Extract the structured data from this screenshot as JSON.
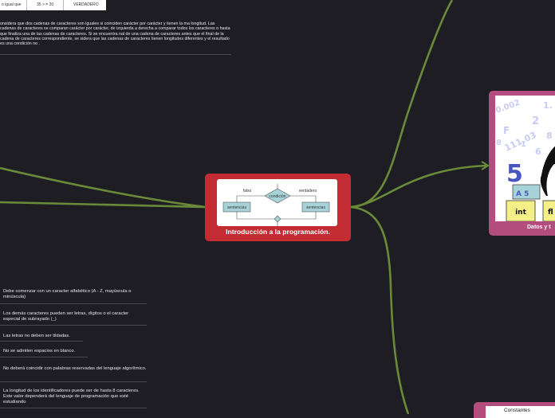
{
  "colors": {
    "background": "#1e1d24",
    "branch": "#6a8a3a",
    "main_card": "#c42c33",
    "secondary_card": "#b34d7d"
  },
  "top_table": {
    "cells": [
      "o igual que",
      "35 > = 20",
      "VERDADERO"
    ]
  },
  "top_note": {
    "text": "onsidera que dos cadenas de caracteres son iguales si coinciden carácter por carácter y tienen la ma longitud. Las cadenas de caracteres se comparan carácter por carácter, de izquierda a derecha a comparar todos los caracteres o hasta que finaliza una de las cadenas de caracteres. Si se encuentra nal de una cadena de caracteres antes que el final de la cadena de caracteres correspondiente, se sidera que las cadenas de caracteres tienen longitudes diferentes y el resultado es una condición no ."
  },
  "main_topic": {
    "title": "Introducción a la programación.",
    "flowchart": {
      "false_label": "falso",
      "condition": "condición",
      "true_label": "verdadero",
      "left_box": "sentencias",
      "right_box": "sentencias"
    }
  },
  "datos_topic": {
    "label": "Datos y t",
    "image_text": {
      "numbers": [
        "0.002",
        "1.",
        "2",
        "F",
        "111.03",
        "6",
        "5",
        "A 5",
        "8",
        "8",
        "1"
      ],
      "box_left": "int",
      "box_right": "fl"
    }
  },
  "constantes_topic": {
    "label": "Constantes"
  },
  "identifier_rules": [
    "Debe comenzar con un caracter alfabético (A - Z, mayúscula o minúscula)",
    "Los demás caracteres pueden ser letras, dígitos o el caracter especial de subrayado (_)",
    "Las letras no deben ser tildadas.",
    "No se admiten espacios en blanco.",
    "No deberá coincidir con palabras reservadas del lenguaje algorítmico.",
    "La longitud de los identificadores puede ser de hasta 8 caracteres.  Este valor dependerá del lenguaje de programación que esté estudiando"
  ]
}
